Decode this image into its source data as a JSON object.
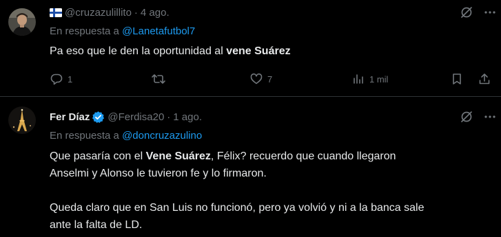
{
  "tweets": [
    {
      "handle": "@cruzazulillito",
      "separator": "·",
      "time": "4 ago.",
      "reply_prefix": "En respuesta a",
      "reply_to": "@Lanetafutbol7",
      "text_before": "Pa eso que le den la oportunidad al ",
      "text_bold": "vene Suárez",
      "replies": "1",
      "retweets": "",
      "likes": "7",
      "views": "1 mil",
      "icons": [
        "finland-flag-icon",
        "grok-icon",
        "reply-icon",
        "retweet-icon",
        "like-icon",
        "views-icon",
        "bookmark-icon",
        "share-icon"
      ]
    },
    {
      "display_name": "Fer Díaz",
      "handle": "@Ferdisa20",
      "separator": "·",
      "time": "1 ago.",
      "reply_prefix": "En respuesta a",
      "reply_to": "@doncruzazulino",
      "text_p1_before": "Que pasaría con el ",
      "text_p1_bold": "Vene Suárez",
      "text_p1_after": ", Félix? recuerdo que cuando llegaron",
      "text_p1_line2": "Anselmi y Alonso le tuvieron fe y lo firmaron.",
      "text_p2_line1": "Queda claro que en San Luis no funcionó, pero ya volvió y ni a la banca sale",
      "text_p2_line2": "ante la falta de LD.",
      "icons": [
        "verified-badge-icon",
        "grok-icon"
      ]
    }
  ],
  "colors": {
    "background": "#000000",
    "text": "#e7e9ea",
    "muted": "#71767b",
    "link": "#1d9bf0",
    "divider": "#2f3336",
    "verified": "#1d9bf0"
  }
}
